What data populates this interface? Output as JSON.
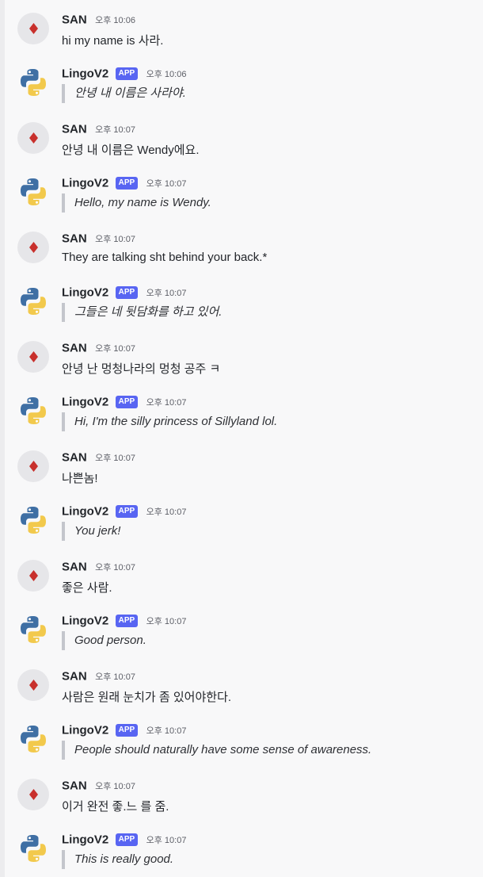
{
  "messages": [
    {
      "author": "SAN",
      "time": "오후 10:06",
      "text": "hi my name is 사라."
    },
    {
      "author": "LingoV2",
      "badge": "APP",
      "time": "오후 10:06",
      "text": "안녕 내 이름은 사라야."
    },
    {
      "author": "SAN",
      "time": "오후 10:07",
      "text": "안녕 내 이름은 Wendy에요."
    },
    {
      "author": "LingoV2",
      "badge": "APP",
      "time": "오후 10:07",
      "text": "Hello, my name is Wendy."
    },
    {
      "author": "SAN",
      "time": "오후 10:07",
      "text": "They are talking sht behind your back.*"
    },
    {
      "author": "LingoV2",
      "badge": "APP",
      "time": "오후 10:07",
      "text": "그들은 네 뒷담화를 하고 있어."
    },
    {
      "author": "SAN",
      "time": "오후 10:07",
      "text": "안녕 난 멍청나라의 멍청 공주 ㅋ"
    },
    {
      "author": "LingoV2",
      "badge": "APP",
      "time": "오후 10:07",
      "text": "Hi, I'm the silly princess of Sillyland lol."
    },
    {
      "author": "SAN",
      "time": "오후 10:07",
      "text": "나쁜놈!"
    },
    {
      "author": "LingoV2",
      "badge": "APP",
      "time": "오후 10:07",
      "text": "You jerk!"
    },
    {
      "author": "SAN",
      "time": "오후 10:07",
      "text": "좋은 사람."
    },
    {
      "author": "LingoV2",
      "badge": "APP",
      "time": "오후 10:07",
      "text": "Good person."
    },
    {
      "author": "SAN",
      "time": "오후 10:07",
      "text": "사람은 원래 눈치가 좀 있어야한다."
    },
    {
      "author": "LingoV2",
      "badge": "APP",
      "time": "오후 10:07",
      "text": "People should naturally have some sense of awareness."
    },
    {
      "author": "SAN",
      "time": "오후 10:07",
      "text": "이거 완전 좋.느 를 줌."
    },
    {
      "author": "LingoV2",
      "badge": "APP",
      "time": "오후 10:07",
      "text": "This is really good."
    }
  ],
  "colors": {
    "badge": "#5865f2",
    "diamond": "#c8302c",
    "python_blue": "#3f6fa4",
    "python_yellow": "#f2c94c"
  },
  "icons": {
    "san_avatar": "red-diamond-icon",
    "bot_avatar": "python-logo-icon"
  }
}
